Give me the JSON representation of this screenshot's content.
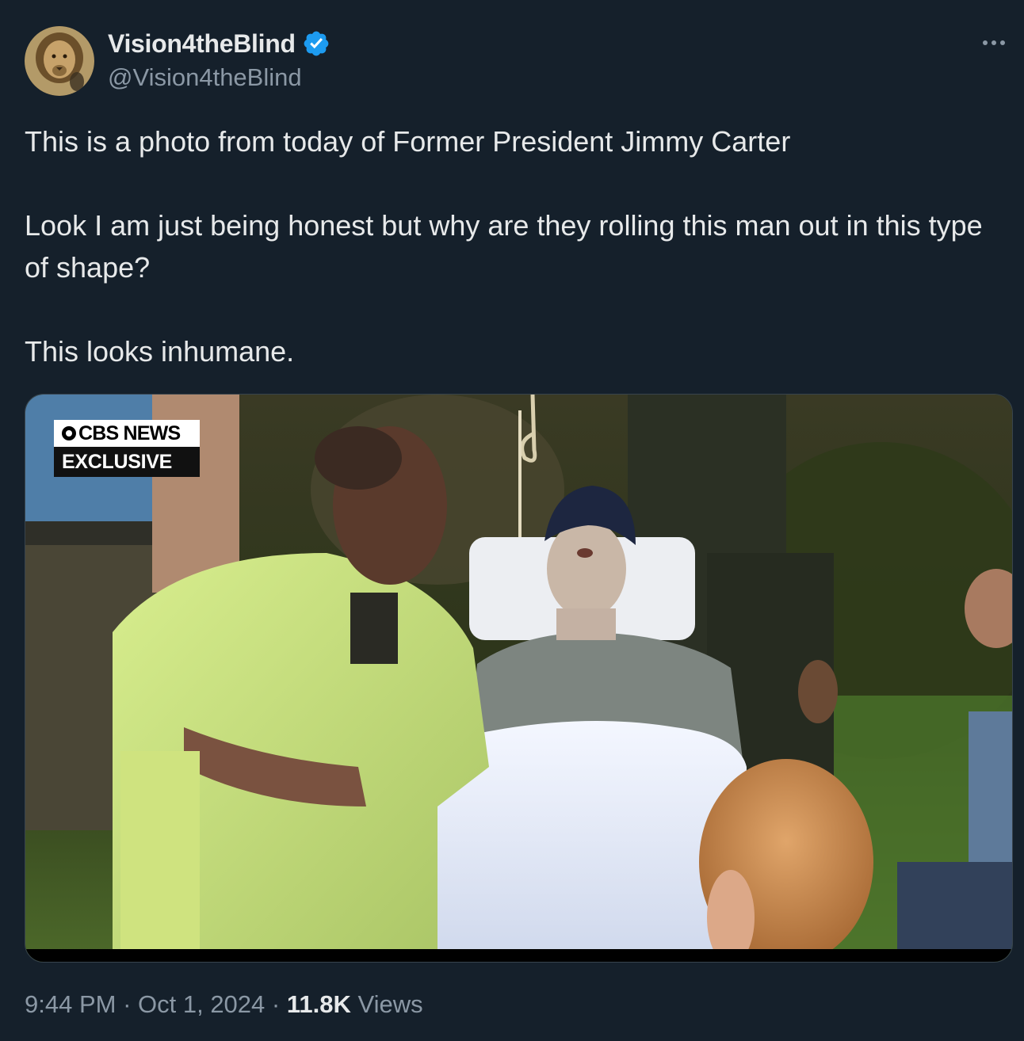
{
  "author": {
    "display_name": "Vision4theBlind",
    "handle": "@Vision4theBlind",
    "verified": true,
    "verified_color": "#1d9bf0",
    "avatar_icon": "lion-avatar"
  },
  "tweet": {
    "paragraphs": [
      "This is a photo from today of Former President Jimmy Carter",
      "Look I am just being honest but why are they rolling this man out in this type of shape?",
      "This looks inhumane."
    ]
  },
  "media": {
    "badge_top": "CBS NEWS",
    "badge_bottom": "EXCLUSIVE"
  },
  "footer": {
    "time": "9:44 PM",
    "separator": " · ",
    "date": "Oct 1, 2024",
    "views_count": "11.8K",
    "views_label": " Views"
  },
  "colors": {
    "background": "#15202b",
    "text_primary": "#e7e9ea",
    "text_secondary": "#8b98a5"
  }
}
